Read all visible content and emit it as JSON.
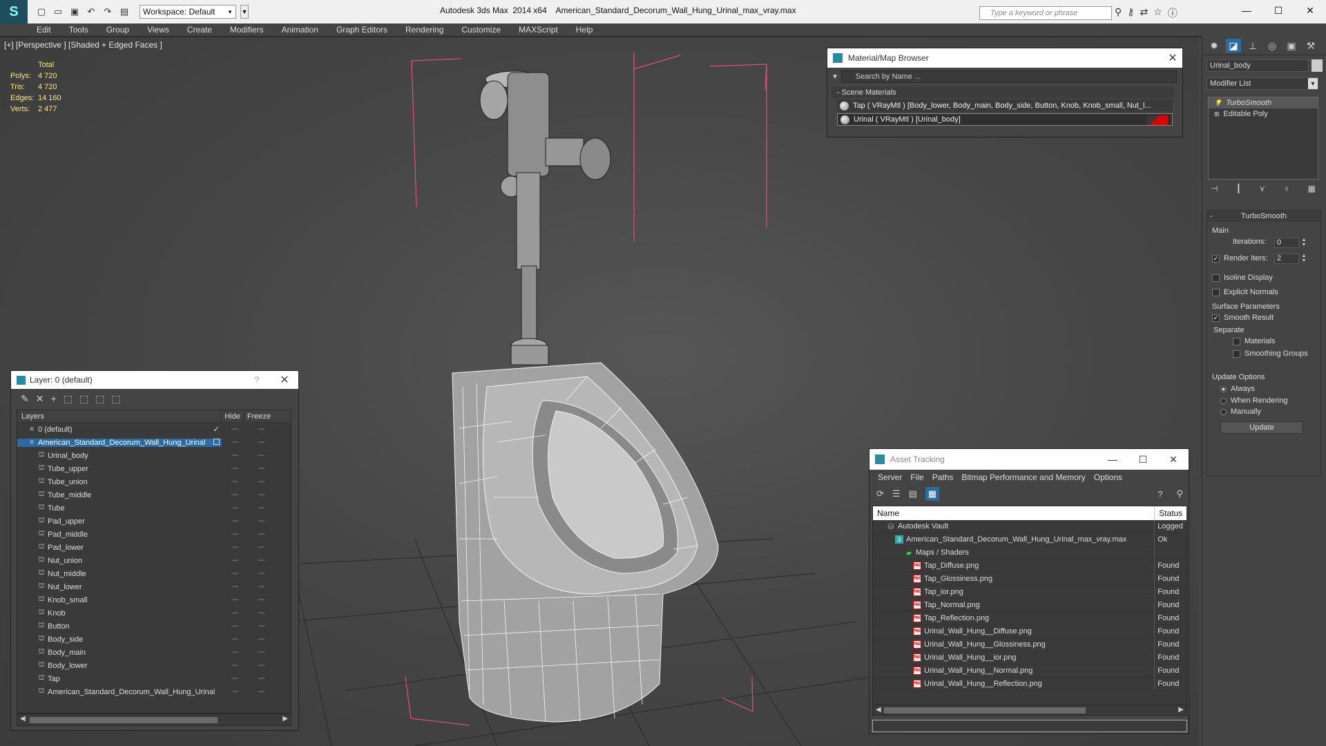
{
  "titlebar": {
    "app_title": "Autodesk 3ds Max  2014 x64",
    "file_title": "American_Standard_Decorum_Wall_Hung_Urinal_max_vray.max",
    "workspace": "Workspace: Default",
    "search_placeholder": "Type a keyword or phrase"
  },
  "menu": [
    "Edit",
    "Tools",
    "Group",
    "Views",
    "Create",
    "Modifiers",
    "Animation",
    "Graph Editors",
    "Rendering",
    "Customize",
    "MAXScript",
    "Help"
  ],
  "viewport": {
    "label": "[+] [Perspective ] [Shaded + Edged Faces ]",
    "stats": {
      "header": "Total",
      "rows": [
        {
          "key": "Polys:",
          "value": "4 720"
        },
        {
          "key": "Tris:",
          "value": "4 720"
        },
        {
          "key": "Edges:",
          "value": "14 160"
        },
        {
          "key": "Verts:",
          "value": "2 477"
        }
      ]
    }
  },
  "material_browser": {
    "title": "Material/Map Browser",
    "search_placeholder": "Search by Name ...",
    "section": "- Scene Materials",
    "items": [
      "Tap  ( VRayMtl ) [Body_lower, Body_main, Body_side, Button, Knob, Knob_small, Nut_l...",
      "Urinal  ( VRayMtl ) [Urinal_body]"
    ]
  },
  "command_panel": {
    "object_name": "Urinal_body",
    "modifier_list": "Modifier List",
    "stack": [
      "TurboSmooth",
      "Editable Poly"
    ],
    "rollout_title": "TurboSmooth",
    "main_group": "Main",
    "iterations_label": "Iterations:",
    "iterations_value": "0",
    "render_iters_label": "Render Iters:",
    "render_iters_value": "2",
    "isoline": "Isoline Display",
    "explicit_normals": "Explicit Normals",
    "surface_params": "Surface Parameters",
    "smooth_result": "Smooth Result",
    "separate": "Separate",
    "materials": "Materials",
    "smoothing_groups": "Smoothing Groups",
    "update_options": "Update Options",
    "always": "Always",
    "when_rendering": "When Rendering",
    "manually": "Manually",
    "update_button": "Update"
  },
  "layer_window": {
    "title": "Layer: 0 (default)",
    "help": "?",
    "columns": {
      "layers": "Layers",
      "hide": "Hide",
      "freeze": "Freeze"
    },
    "rows": [
      {
        "name": "0 (default)",
        "level": 1,
        "type": "layer",
        "check": "✓"
      },
      {
        "name": "American_Standard_Decorum_Wall_Hung_Urinal",
        "level": 1,
        "type": "layer",
        "selected": true
      },
      {
        "name": "Urinal_body",
        "level": 2,
        "type": "object"
      },
      {
        "name": "Tube_upper",
        "level": 2,
        "type": "object"
      },
      {
        "name": "Tube_union",
        "level": 2,
        "type": "object"
      },
      {
        "name": "Tube_middle",
        "level": 2,
        "type": "object"
      },
      {
        "name": "Tube",
        "level": 2,
        "type": "object"
      },
      {
        "name": "Pad_upper",
        "level": 2,
        "type": "object"
      },
      {
        "name": "Pad_middle",
        "level": 2,
        "type": "object"
      },
      {
        "name": "Pad_lower",
        "level": 2,
        "type": "object"
      },
      {
        "name": "Nut_union",
        "level": 2,
        "type": "object"
      },
      {
        "name": "Nut_middle",
        "level": 2,
        "type": "object"
      },
      {
        "name": "Nut_lower",
        "level": 2,
        "type": "object"
      },
      {
        "name": "Knob_small",
        "level": 2,
        "type": "object"
      },
      {
        "name": "Knob",
        "level": 2,
        "type": "object"
      },
      {
        "name": "Button",
        "level": 2,
        "type": "object"
      },
      {
        "name": "Body_side",
        "level": 2,
        "type": "object"
      },
      {
        "name": "Body_main",
        "level": 2,
        "type": "object"
      },
      {
        "name": "Body_lower",
        "level": 2,
        "type": "object"
      },
      {
        "name": "Tap",
        "level": 2,
        "type": "object"
      },
      {
        "name": "American_Standard_Decorum_Wall_Hung_Urinal",
        "level": 2,
        "type": "object"
      }
    ]
  },
  "asset_tracking": {
    "title": "Asset Tracking",
    "menu": [
      "Server",
      "File",
      "Paths",
      "Bitmap Performance and Memory",
      "Options"
    ],
    "columns": {
      "name": "Name",
      "status": "Status"
    },
    "rows": [
      {
        "name": "Autodesk Vault",
        "status": "Logged",
        "icon": "vault"
      },
      {
        "name": "American_Standard_Decorum_Wall_Hung_Urinal_max_vray.max",
        "status": "Ok",
        "icon": "max"
      },
      {
        "name": "Maps / Shaders",
        "status": "",
        "icon": "map"
      },
      {
        "name": "Tap_Diffuse.png",
        "status": "Found",
        "icon": "png"
      },
      {
        "name": "Tap_Glossiness.png",
        "status": "Found",
        "icon": "png"
      },
      {
        "name": "Tap_ior.png",
        "status": "Found",
        "icon": "png"
      },
      {
        "name": "Tap_Normal.png",
        "status": "Found",
        "icon": "png"
      },
      {
        "name": "Tap_Reflection.png",
        "status": "Found",
        "icon": "png"
      },
      {
        "name": "Urinal_Wall_Hung__Diffuse.png",
        "status": "Found",
        "icon": "png"
      },
      {
        "name": "Urinal_Wall_Hung__Glossiness.png",
        "status": "Found",
        "icon": "png"
      },
      {
        "name": "Urinal_Wall_Hung__ior.png",
        "status": "Found",
        "icon": "png"
      },
      {
        "name": "Urinal_Wall_Hung__Normal.png",
        "status": "Found",
        "icon": "png"
      },
      {
        "name": "Urinal_Wall_Hung__Reflection.png",
        "status": "Found",
        "icon": "png"
      }
    ]
  },
  "colors": {
    "accent": "#2d6aa0",
    "stats_text": "#ffe87a",
    "bounding_box": "#e0507a",
    "urinal_swatch": "#dd0000"
  }
}
